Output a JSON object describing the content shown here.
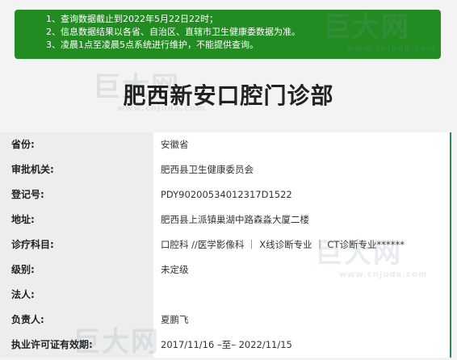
{
  "notice": {
    "lines": [
      "1、查询数据截止到2022年5月22日22时；",
      "2、信息数据结果以各省、自治区、直辖市卫生健康委数据为准。",
      "3、凌晨1点至凌晨5点系统进行维护，不能提供查询。"
    ],
    "color": "#228c22"
  },
  "page_title": "肥西新安口腔门诊部",
  "watermark": {
    "brand": "巨大网",
    "domain": "www.cnjuda.com"
  },
  "rows": [
    {
      "label": "省份:",
      "value": "安徽省"
    },
    {
      "label": "审批机关:",
      "value": "肥西县卫生健康委员会"
    },
    {
      "label": "登记号:",
      "value": "PDY90200534012317D1522"
    },
    {
      "label": "地址:",
      "value": "肥西县上派镇巢湖中路森淼大厦二楼"
    },
    {
      "label": "诊疗科目:",
      "value": "口腔科 //医学影像科 ｜ X线诊断专业 ｜ CT诊断专业******"
    },
    {
      "label": "级别:",
      "value": "未定级"
    },
    {
      "label": "法人:",
      "value": ""
    },
    {
      "label": "负责人:",
      "value": "夏鹏飞"
    },
    {
      "label": "执业许可证有效期:",
      "value": "2017/11/16 –至– 2022/11/15"
    }
  ]
}
